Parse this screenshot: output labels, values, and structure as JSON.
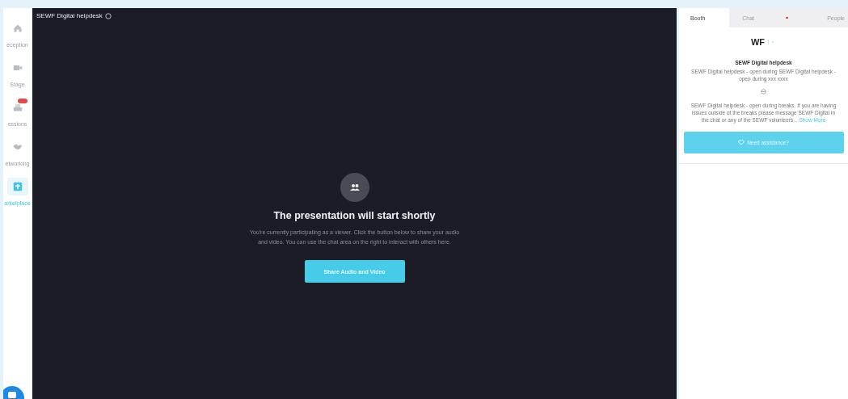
{
  "sidebar": {
    "items": [
      {
        "kind": "home",
        "label": "eception",
        "selected": false,
        "badge": false
      },
      {
        "kind": "camera",
        "label": "Stage",
        "selected": false,
        "badge": false
      },
      {
        "kind": "sessions",
        "label": "essions",
        "selected": false,
        "badge": true
      },
      {
        "kind": "handshake",
        "label": "etworking",
        "selected": false,
        "badge": false
      },
      {
        "kind": "store",
        "label": "arketplace",
        "selected": true,
        "badge": false
      }
    ]
  },
  "stage": {
    "title": "SEWF Digital helpdesk",
    "heading": "The presentation will start shortly",
    "message": "You're currently participating as a viewer. Click the button below to share your audio and video. You can use the chat area on the right to interact with others here.",
    "button": "Share Audio and Video"
  },
  "panel": {
    "tabs": [
      {
        "kind": "text",
        "label": "Booth",
        "selected": true
      },
      {
        "kind": "text",
        "label": "Chat",
        "selected": false
      },
      {
        "kind": "dot",
        "selected": false
      },
      {
        "kind": "text",
        "label": "People",
        "selected": false
      }
    ],
    "logo": "WF",
    "name": "SEWF Digital helpdesk",
    "tagline": "SEWF Digital helpdesk - open during SEWF Digital helpdesk - open during xxx xxxx",
    "description": "SEWF Digital helpdesk - open during breaks. If you are having issues outside of the breaks please message SEWF Digital in the chat or any of the SEWF volunteers...",
    "show_more": "Show More",
    "button": "Need assistance?"
  }
}
